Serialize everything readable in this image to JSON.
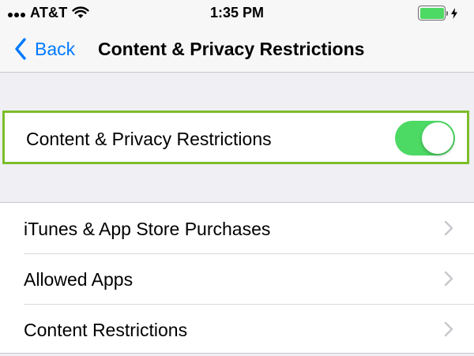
{
  "status_bar": {
    "carrier": "AT&T",
    "time": "1:35 PM",
    "battery_level": 1.0,
    "signal_bars": 3,
    "icons": [
      "signal-icon",
      "wifi-icon",
      "battery-icon",
      "charging-bolt-icon"
    ]
  },
  "nav": {
    "back_label": "Back",
    "title": "Content & Privacy Restrictions",
    "back_icon": "chevron-left-icon"
  },
  "toggle_row": {
    "label": "Content & Privacy Restrictions",
    "enabled": true
  },
  "list": {
    "items": [
      {
        "label": "iTunes & App Store Purchases",
        "icon": "chevron-right-icon"
      },
      {
        "label": "Allowed Apps",
        "icon": "chevron-right-icon"
      },
      {
        "label": "Content Restrictions",
        "icon": "chevron-right-icon"
      }
    ]
  },
  "colors": {
    "tint": "#007aff",
    "switch_on": "#4cd964",
    "highlight_border": "#7cbd29",
    "group_background": "#efeff4",
    "separator": "#c8c7cc",
    "chevron": "#c7c7cc"
  }
}
